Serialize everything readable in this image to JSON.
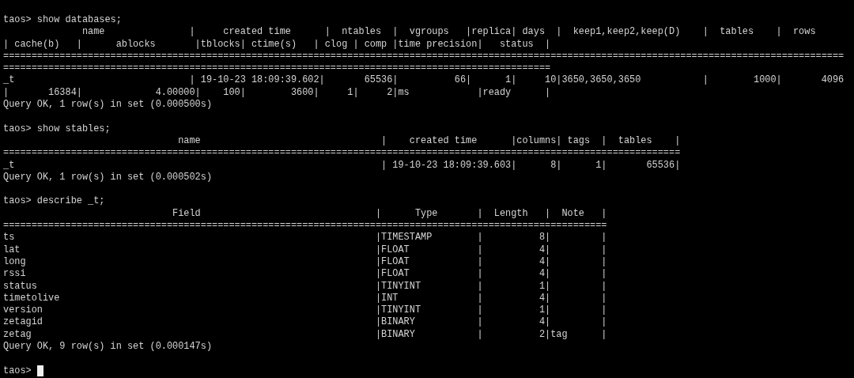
{
  "sessions": [
    {
      "command_line": "taos> show databases;",
      "output": [
        "              name               |     created time      |  ntables  |  vgroups   |replica| days  |  keep1,keep2,keep(D)    |  tables    |  rows",
        "| cache(b)   |      ablocks       |tblocks| ctime(s)   | clog | comp |time precision|   status  |",
        "=====================================================================================================================================================",
        "=================================================================================================",
        "_t                               | 19-10-23 18:09:39.602|       65536|          66|      1|     10|3650,3650,3650           |        1000|       4096",
        "|       16384|             4.00000|    100|        3600|     1|     2|ms            |ready      |",
        "Query OK, 1 row(s) in set (0.000500s)"
      ]
    },
    {
      "command_line": "taos> show stables;",
      "output": [
        "                               name                                |    created time      |columns| tags  |  tables    |",
        "========================================================================================================================",
        "_t                                                                 | 19-10-23 18:09:39.603|      8|      1|       65536|",
        "Query OK, 1 row(s) in set (0.000502s)"
      ]
    },
    {
      "command_line": "taos> describe _t;",
      "output": [
        "                              Field                               |      Type       |  Length   |  Note   |",
        "===========================================================================================================",
        "ts                                                                |TIMESTAMP        |          8|         |",
        "lat                                                               |FLOAT            |          4|         |",
        "long                                                              |FLOAT            |          4|         |",
        "rssi                                                              |FLOAT            |          4|         |",
        "status                                                            |TINYINT          |          1|         |",
        "timetolive                                                        |INT              |          4|         |",
        "version                                                           |TINYINT          |          1|         |",
        "zetagid                                                           |BINARY           |          4|         |",
        "zetag                                                             |BINARY           |          2|tag      |",
        "Query OK, 9 row(s) in set (0.000147s)"
      ]
    }
  ],
  "input": {
    "prompt": "taos>",
    "cursor": true
  }
}
